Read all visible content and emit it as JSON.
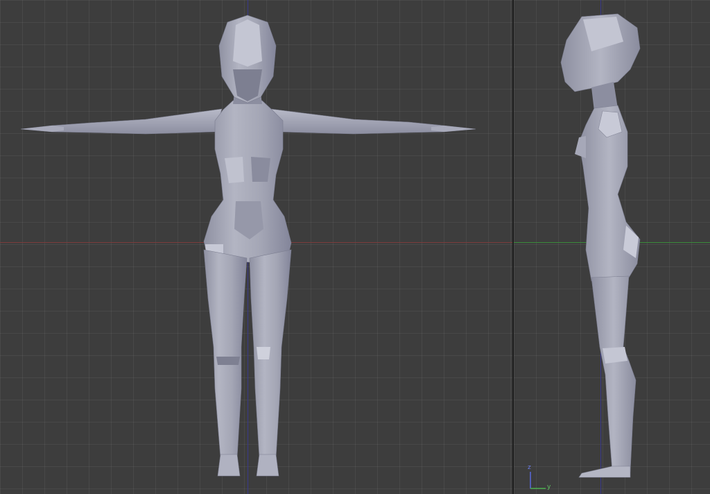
{
  "viewports": {
    "front": {
      "model": "mesh-front-view"
    },
    "side": {
      "model": "mesh-side-view",
      "gizmo": {
        "up_label": "z",
        "right_label": "y"
      }
    }
  },
  "colors": {
    "background": "#3d3d3d",
    "grid": "#4a4a4a",
    "x_axis": "#8a3c3c",
    "y_axis": "#3a8a3a",
    "z_axis": "#3a3a8a",
    "mesh_light": "#b4b6c4",
    "mesh_mid": "#9597a6",
    "mesh_dark": "#76788a",
    "gizmo_z": "#5a6adc",
    "gizmo_y": "#4caf50"
  }
}
